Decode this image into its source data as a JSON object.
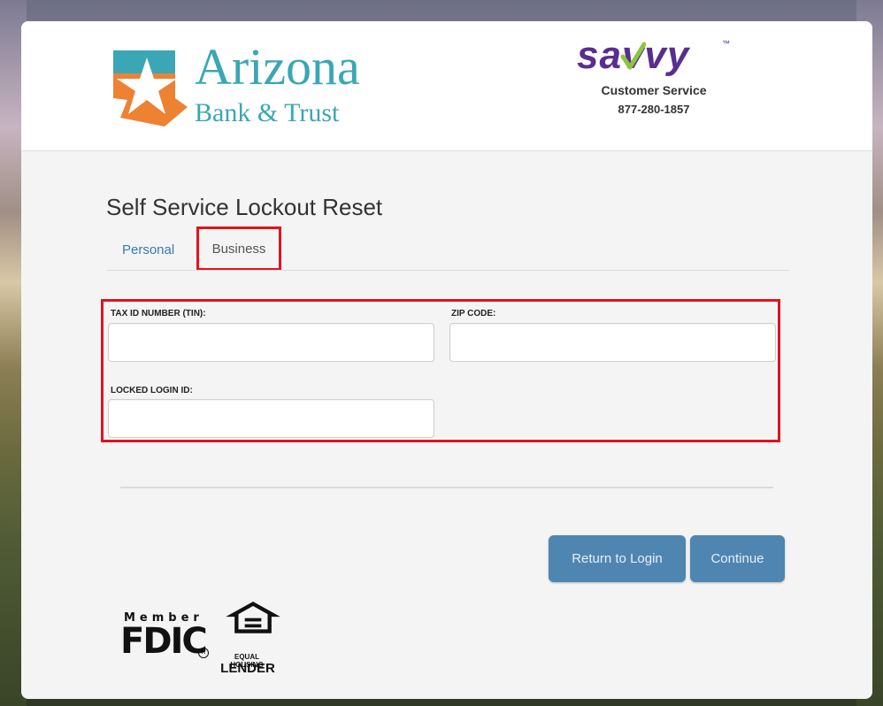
{
  "brand": {
    "name_line1": "Arizona",
    "name_line2": "Bank & Trust",
    "primary_color": "#3aa6b6",
    "accent_orange": "#ee8233",
    "logo_icon": "arizona-star-emblem"
  },
  "partner": {
    "name": "savvy",
    "tm": "™",
    "color": "#5a2d91",
    "check_color": "#8cc63f",
    "cs_label": "Customer Service",
    "cs_phone": "877-280-1857"
  },
  "page": {
    "title": "Self Service Lockout Reset"
  },
  "tabs": [
    {
      "label": "Personal",
      "active": false
    },
    {
      "label": "Business",
      "active": true
    }
  ],
  "form": {
    "tin_label": "TAX ID NUMBER (TIN):",
    "tin_value": "",
    "zip_label": "ZIP CODE:",
    "zip_value": "",
    "login_label": "LOCKED LOGIN ID:",
    "login_value": ""
  },
  "actions": {
    "return_label": "Return to Login",
    "continue_label": "Continue",
    "button_color": "#4f86b1"
  },
  "footer": {
    "fdic_member": "Member",
    "fdic": "FDIC",
    "ehl_line1": "EQUAL HOUSING",
    "ehl_line2": "LENDER",
    "highlight_color": "#e0141e"
  }
}
